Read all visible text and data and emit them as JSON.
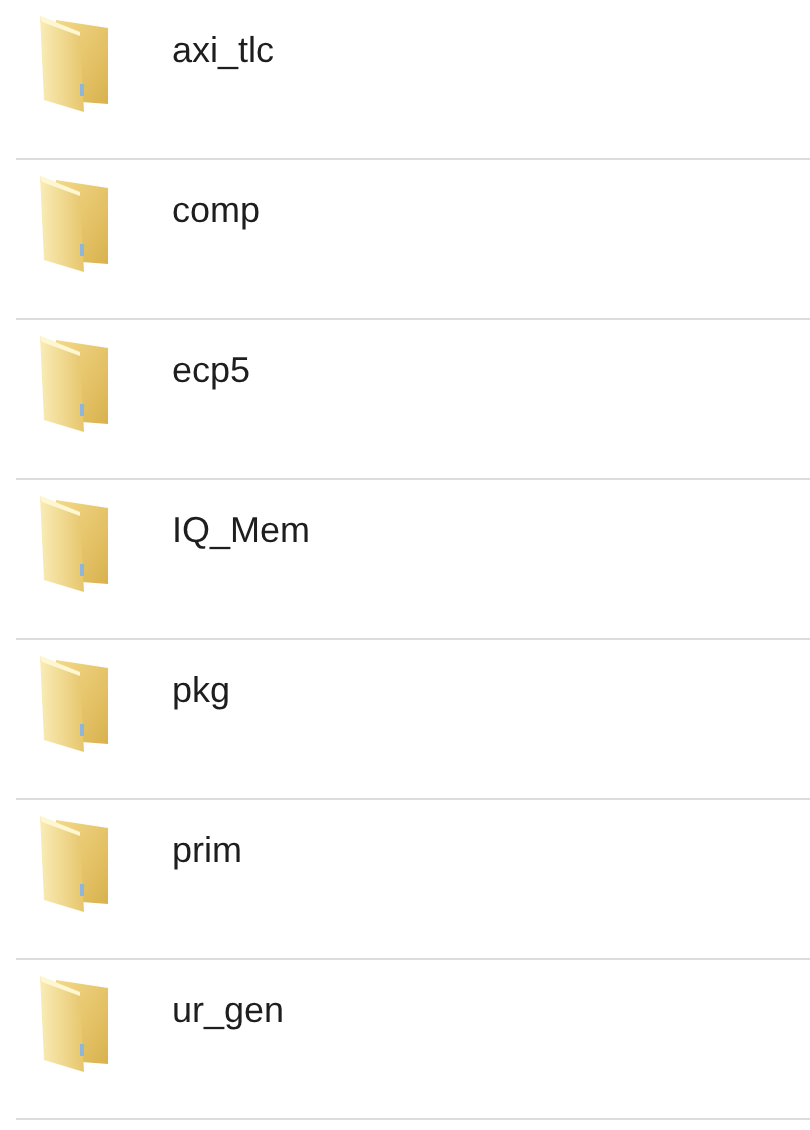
{
  "folders": [
    {
      "name": "axi_tlc"
    },
    {
      "name": "comp"
    },
    {
      "name": "ecp5"
    },
    {
      "name": "IQ_Mem"
    },
    {
      "name": "pkg"
    },
    {
      "name": "prim"
    },
    {
      "name": "ur_gen"
    }
  ]
}
